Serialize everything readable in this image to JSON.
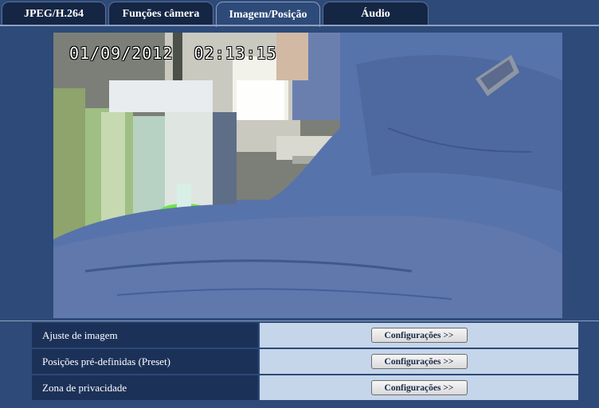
{
  "tabs": [
    {
      "label": "JPEG/H.264",
      "active": false
    },
    {
      "label": "Funções câmera",
      "active": false
    },
    {
      "label": "Imagem/Posição",
      "active": true
    },
    {
      "label": "Áudio",
      "active": false
    }
  ],
  "camera": {
    "osd_date": "01/09/2012",
    "osd_time": "02:13:15"
  },
  "settings": {
    "rows": [
      {
        "label": "Ajuste de imagem",
        "button": "Configurações >>"
      },
      {
        "label": "Posições pré-definidas (Preset)",
        "button": "Configurações >>"
      },
      {
        "label": "Zona de privacidade",
        "button": "Configurações >>"
      }
    ]
  },
  "colors": {
    "background": "#2d4a78",
    "tab_inactive": "#152644",
    "row_label_bg": "#1c3158",
    "row_value_bg": "#c5d5ea"
  }
}
